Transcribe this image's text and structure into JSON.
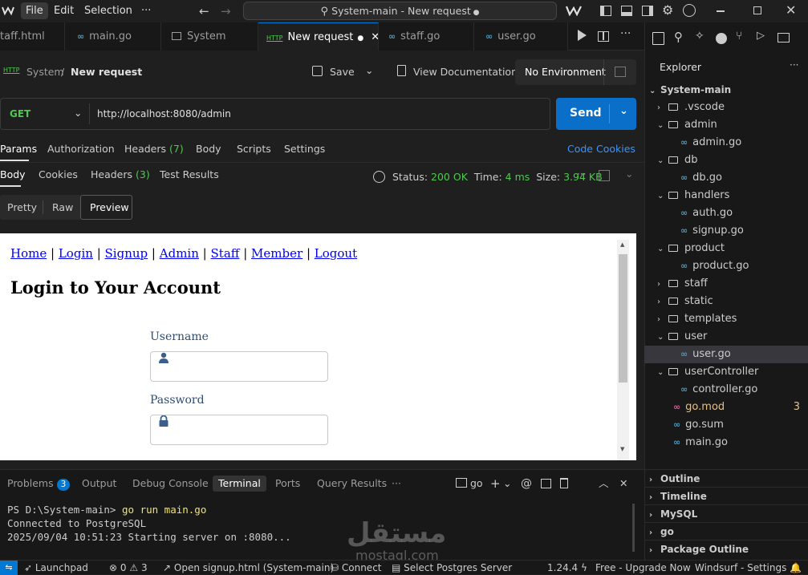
{
  "menu": {
    "file": "File",
    "edit": "Edit",
    "selection": "Selection",
    "more": "···"
  },
  "command_center": "System-main - New request",
  "tabs": [
    "taff.html",
    "main.go",
    "System",
    "New request",
    "staff.go",
    "user.go"
  ],
  "request": {
    "breadcrumb_parent": "System",
    "breadcrumb_sep": "/",
    "breadcrumb_current": "New request",
    "save": "Save",
    "view_docs": "View Documentation",
    "environment": "No Environment",
    "method": "GET",
    "url": "http://localhost:8080/admin",
    "send": "Send"
  },
  "request_tabs": {
    "params": "Params",
    "authorization": "Authorization",
    "headers": "Headers",
    "headers_count": "(7)",
    "body": "Body",
    "scripts": "Scripts",
    "settings": "Settings",
    "code": "Code",
    "cookies": "Cookies"
  },
  "response_tabs": {
    "body": "Body",
    "cookies": "Cookies",
    "headers": "Headers",
    "headers_count": "(3)",
    "test_results": "Test Results",
    "status_label": "Status:",
    "status_value": "200 OK",
    "time_label": "Time:",
    "time_value": "4 ms",
    "size_label": "Size:",
    "size_value": "3.94 KB"
  },
  "view_modes": [
    "Pretty",
    "Raw",
    "Preview"
  ],
  "preview": {
    "nav": [
      "Home",
      "Login",
      "Signup",
      "Admin",
      "Staff",
      "Member",
      "Logout"
    ],
    "nav_sep": "|",
    "heading": "Login to Your Account",
    "username_label": "Username",
    "password_label": "Password"
  },
  "explorer": {
    "title": "Explorer",
    "more": "···",
    "root": "System-main",
    "items": [
      {
        "name": ".vscode",
        "kind": "folder",
        "open": false,
        "depth": 1
      },
      {
        "name": "admin",
        "kind": "folder",
        "open": true,
        "depth": 1
      },
      {
        "name": "admin.go",
        "kind": "go",
        "depth": 2
      },
      {
        "name": "db",
        "kind": "folder",
        "open": true,
        "depth": 1
      },
      {
        "name": "db.go",
        "kind": "go",
        "depth": 2
      },
      {
        "name": "handlers",
        "kind": "folder",
        "open": true,
        "depth": 1
      },
      {
        "name": "auth.go",
        "kind": "go",
        "depth": 2
      },
      {
        "name": "signup.go",
        "kind": "go",
        "depth": 2
      },
      {
        "name": "product",
        "kind": "folder",
        "open": true,
        "depth": 1
      },
      {
        "name": "product.go",
        "kind": "go",
        "depth": 2
      },
      {
        "name": "staff",
        "kind": "folder",
        "open": false,
        "depth": 1
      },
      {
        "name": "static",
        "kind": "folder",
        "open": false,
        "depth": 1
      },
      {
        "name": "templates",
        "kind": "folder",
        "open": false,
        "depth": 1
      },
      {
        "name": "user",
        "kind": "folder",
        "open": true,
        "depth": 1
      },
      {
        "name": "user.go",
        "kind": "go",
        "depth": 2,
        "selected": true
      },
      {
        "name": "userController",
        "kind": "folder",
        "open": true,
        "depth": 1
      },
      {
        "name": "controller.go",
        "kind": "go",
        "depth": 2
      },
      {
        "name": "go.mod",
        "kind": "mod",
        "depth": 1,
        "badge": "3"
      },
      {
        "name": "go.sum",
        "kind": "go",
        "depth": 1
      },
      {
        "name": "main.go",
        "kind": "go",
        "depth": 1
      }
    ],
    "sections": [
      "Outline",
      "Timeline",
      "MySQL",
      "go",
      "Package Outline"
    ]
  },
  "panel": {
    "tabs": [
      "Problems",
      "Output",
      "Debug Console",
      "Terminal",
      "Ports",
      "Query Results"
    ],
    "problems_count": "3",
    "more": "···",
    "shell": "go",
    "terminal_lines": [
      "PS D:\\System-main> ",
      "Connected to PostgreSQL",
      "2025/09/04 10:51:23 Starting server on :8080..."
    ],
    "command": "go run main.go"
  },
  "status": {
    "launchpad": "Launchpad",
    "errors": "0",
    "warnings": "3",
    "open_signup": "Open signup.html (System-main)",
    "connect": "Connect",
    "postgres": "Select Postgres Server",
    "go_version": "1.24.4",
    "upgrade": "Free - Upgrade Now",
    "windsurf": "Windsurf - Settings"
  },
  "watermark": "mostaql.com",
  "colors": {
    "accent": "#0078d4",
    "send": "#0a6fc9",
    "ok": "#4ec94e",
    "go": "#519aba",
    "mod": "#e2c08d"
  }
}
